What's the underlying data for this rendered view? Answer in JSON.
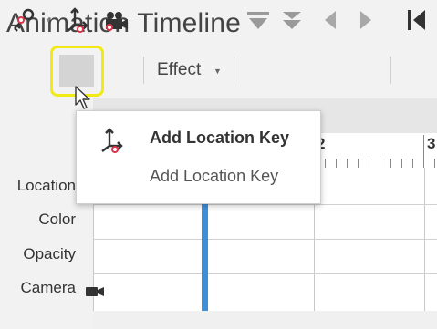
{
  "window": {
    "title": "Animation Timeline"
  },
  "toolbar": {
    "key_button": {
      "icon": "key-icon"
    },
    "location_key_button": {
      "icon": "location-key-icon"
    },
    "camera_key_button": {
      "icon": "camera-key-icon"
    },
    "effect_label": "Effect",
    "move_down_icon": "move-down-icon",
    "move_down_all_icon": "move-down-all-icon",
    "prev_icon": "previous-icon",
    "next_icon": "next-icon",
    "first_icon": "go-to-start-icon"
  },
  "tooltip": {
    "title": "Add Location Key",
    "description": "Add Location Key"
  },
  "ruler": {
    "labels": [
      "2",
      "3"
    ]
  },
  "tracks": [
    {
      "label": "Location"
    },
    {
      "label": "Color"
    },
    {
      "label": "Opacity"
    },
    {
      "label": "Camera"
    }
  ],
  "colors": {
    "highlight": "#f2ea16",
    "playhead": "#3f8fd8",
    "key_red": "#d9344a"
  }
}
